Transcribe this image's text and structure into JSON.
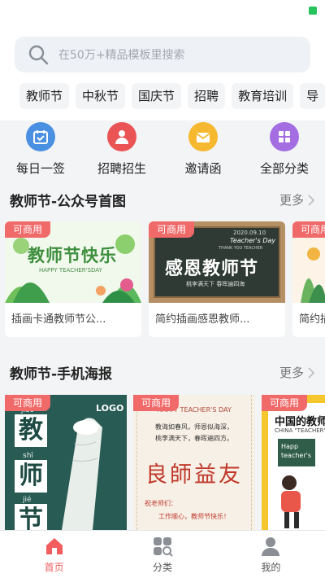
{
  "search": {
    "placeholder": "在50万+精品模板里搜索"
  },
  "chips": [
    "教师节",
    "中秋节",
    "国庆节",
    "招聘",
    "教育培训",
    "导"
  ],
  "quick_actions": [
    {
      "label": "每日一签",
      "icon": "calendar-icon",
      "color": "#4a90e2"
    },
    {
      "label": "招聘招生",
      "icon": "recruit-person-icon",
      "color": "#ea5455"
    },
    {
      "label": "邀请函",
      "icon": "envelope-icon",
      "color": "#f5b82e"
    },
    {
      "label": "全部分类",
      "icon": "grid-icon",
      "color": "#a56de2"
    }
  ],
  "section1": {
    "title": "教师节-公众号首图",
    "more": "更多",
    "cards": [
      {
        "badge": "可商用",
        "title": "插画卡通教师节公...",
        "art_title": "教师节快乐",
        "art_sub": "HAPPY TEACHER'SDAY"
      },
      {
        "badge": "可商用",
        "title": "简约插画感恩教师...",
        "art_title": "感恩教师节",
        "art_sub": "THANK YOU TEACHER",
        "art_date": "2020.09.10",
        "art_tag": "Teacher's Day",
        "art_line": "桃李满天下 春晖遍四海"
      },
      {
        "badge": "可商用",
        "title": "简约插..."
      }
    ]
  },
  "section2": {
    "title": "教师节-手机海报",
    "more": "更多",
    "posters": [
      {
        "badge": "可商用",
        "logo": "LOGO",
        "chars": [
          {
            "pinyin": "jiào",
            "hanzi": "教"
          },
          {
            "pinyin": "shī",
            "hanzi": "师"
          },
          {
            "pinyin": "jié",
            "hanzi": "节"
          }
        ]
      },
      {
        "badge": "可商用",
        "head": "HAPPY TEACHER'S DAY",
        "line1": "教诲如春风，师恩似海深，",
        "line2": "桃李满天下，春晖遍四方。",
        "calligraphy": "良師益友",
        "greet": "祝老师们：",
        "wish": "工作顺心，教师节快乐！"
      },
      {
        "badge": "可商用",
        "title": "中国的教师",
        "sub": "CHINA \"TEACHER\"",
        "bubble1": "Happ",
        "bubble2": "teacher's"
      }
    ]
  },
  "tabbar": [
    {
      "label": "首页",
      "icon": "home-icon",
      "active": true
    },
    {
      "label": "分类",
      "icon": "category-icon",
      "active": false
    },
    {
      "label": "我的",
      "icon": "profile-icon",
      "active": false
    }
  ],
  "colors": {
    "accent": "#f25e5e",
    "badge": "#f06a6a",
    "status": "#27c35b"
  }
}
